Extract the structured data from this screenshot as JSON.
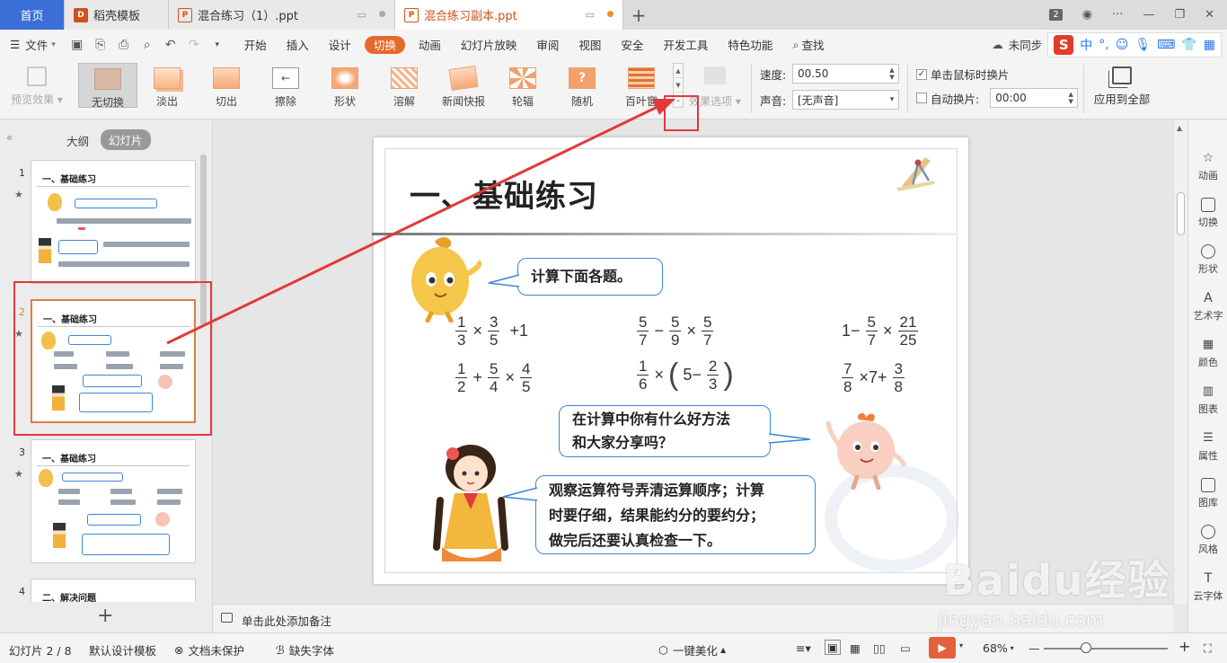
{
  "tabs": [
    {
      "label": "首页"
    },
    {
      "label": "稻壳模板"
    },
    {
      "label": "混合练习（1）.ppt"
    },
    {
      "label": "混合练习副本.ppt"
    }
  ],
  "window": {
    "badge": "2"
  },
  "menu": {
    "file": "文件",
    "items": [
      "开始",
      "插入",
      "设计",
      "切换",
      "动画",
      "幻灯片放映",
      "审阅",
      "视图",
      "安全",
      "开发工具",
      "特色功能"
    ],
    "search": "查找",
    "sync": "未同步"
  },
  "ime": {
    "lang": "中"
  },
  "ribbon": {
    "preview": "预览效果",
    "transitions": [
      "无切换",
      "淡出",
      "切出",
      "擦除",
      "形状",
      "溶解",
      "新闻快报",
      "轮辐",
      "随机",
      "百叶窗"
    ],
    "effect_options": "效果选项",
    "speed_label": "速度:",
    "speed_value": "00.50",
    "sound_label": "声音:",
    "sound_value": "[无声音]",
    "on_click": "单击鼠标时换片",
    "auto": "自动换片:",
    "auto_value": "00:00",
    "apply_all": "应用到全部"
  },
  "leftpanel": {
    "outline": "大纲",
    "slides": "幻灯片",
    "thumbs": [
      {
        "num": "1",
        "title": "一、基础练习"
      },
      {
        "num": "2",
        "title": "一、基础练习"
      },
      {
        "num": "3",
        "title": "一、基础练习"
      },
      {
        "num": "4",
        "title": "二、解决问题"
      }
    ]
  },
  "slide": {
    "title": "一、基础练习",
    "bubble1": "计算下面各题。",
    "bubble2_l1": "在计算中你有什么好方法",
    "bubble2_l2": "和大家分享吗？",
    "bubble3_l1": "观察运算符号弄清运算顺序；计算",
    "bubble3_l2": "时要仔细，结果能约分的要约分；",
    "bubble3_l3": "做完后还要认真检查一下。",
    "e1": {
      "a_n": "1",
      "a_d": "3",
      "b_n": "3",
      "b_d": "5",
      "tail": "+1"
    },
    "e2": {
      "a_n": "5",
      "a_d": "7",
      "b_n": "5",
      "b_d": "9",
      "c_n": "5",
      "c_d": "7"
    },
    "e3": {
      "lead": "1−",
      "a_n": "5",
      "a_d": "7",
      "b_n": "21",
      "b_d": "25"
    },
    "e4": {
      "a_n": "1",
      "a_d": "2",
      "b_n": "5",
      "b_d": "4",
      "c_n": "4",
      "c_d": "5"
    },
    "e5": {
      "a_n": "1",
      "a_d": "6",
      "inner": "5−",
      "b_n": "2",
      "b_d": "3"
    },
    "e6": {
      "a_n": "7",
      "a_d": "8",
      "mid": "×7+",
      "b_n": "3",
      "b_d": "8"
    }
  },
  "notes": {
    "placeholder": "单击此处添加备注"
  },
  "rightsidebar": [
    "动画",
    "切换",
    "形状",
    "艺术字",
    "颜色",
    "图表",
    "属性",
    "图库",
    "风格",
    "云字体"
  ],
  "status": {
    "slide": "幻灯片 2 / 8",
    "theme": "默认设计模板",
    "protect": "文档未保护",
    "font": "缺失字体",
    "beautify": "一键美化",
    "zoom": "68%"
  },
  "watermark": {
    "brand": "Baidu经验",
    "url": "jingyan.baidu.com"
  }
}
